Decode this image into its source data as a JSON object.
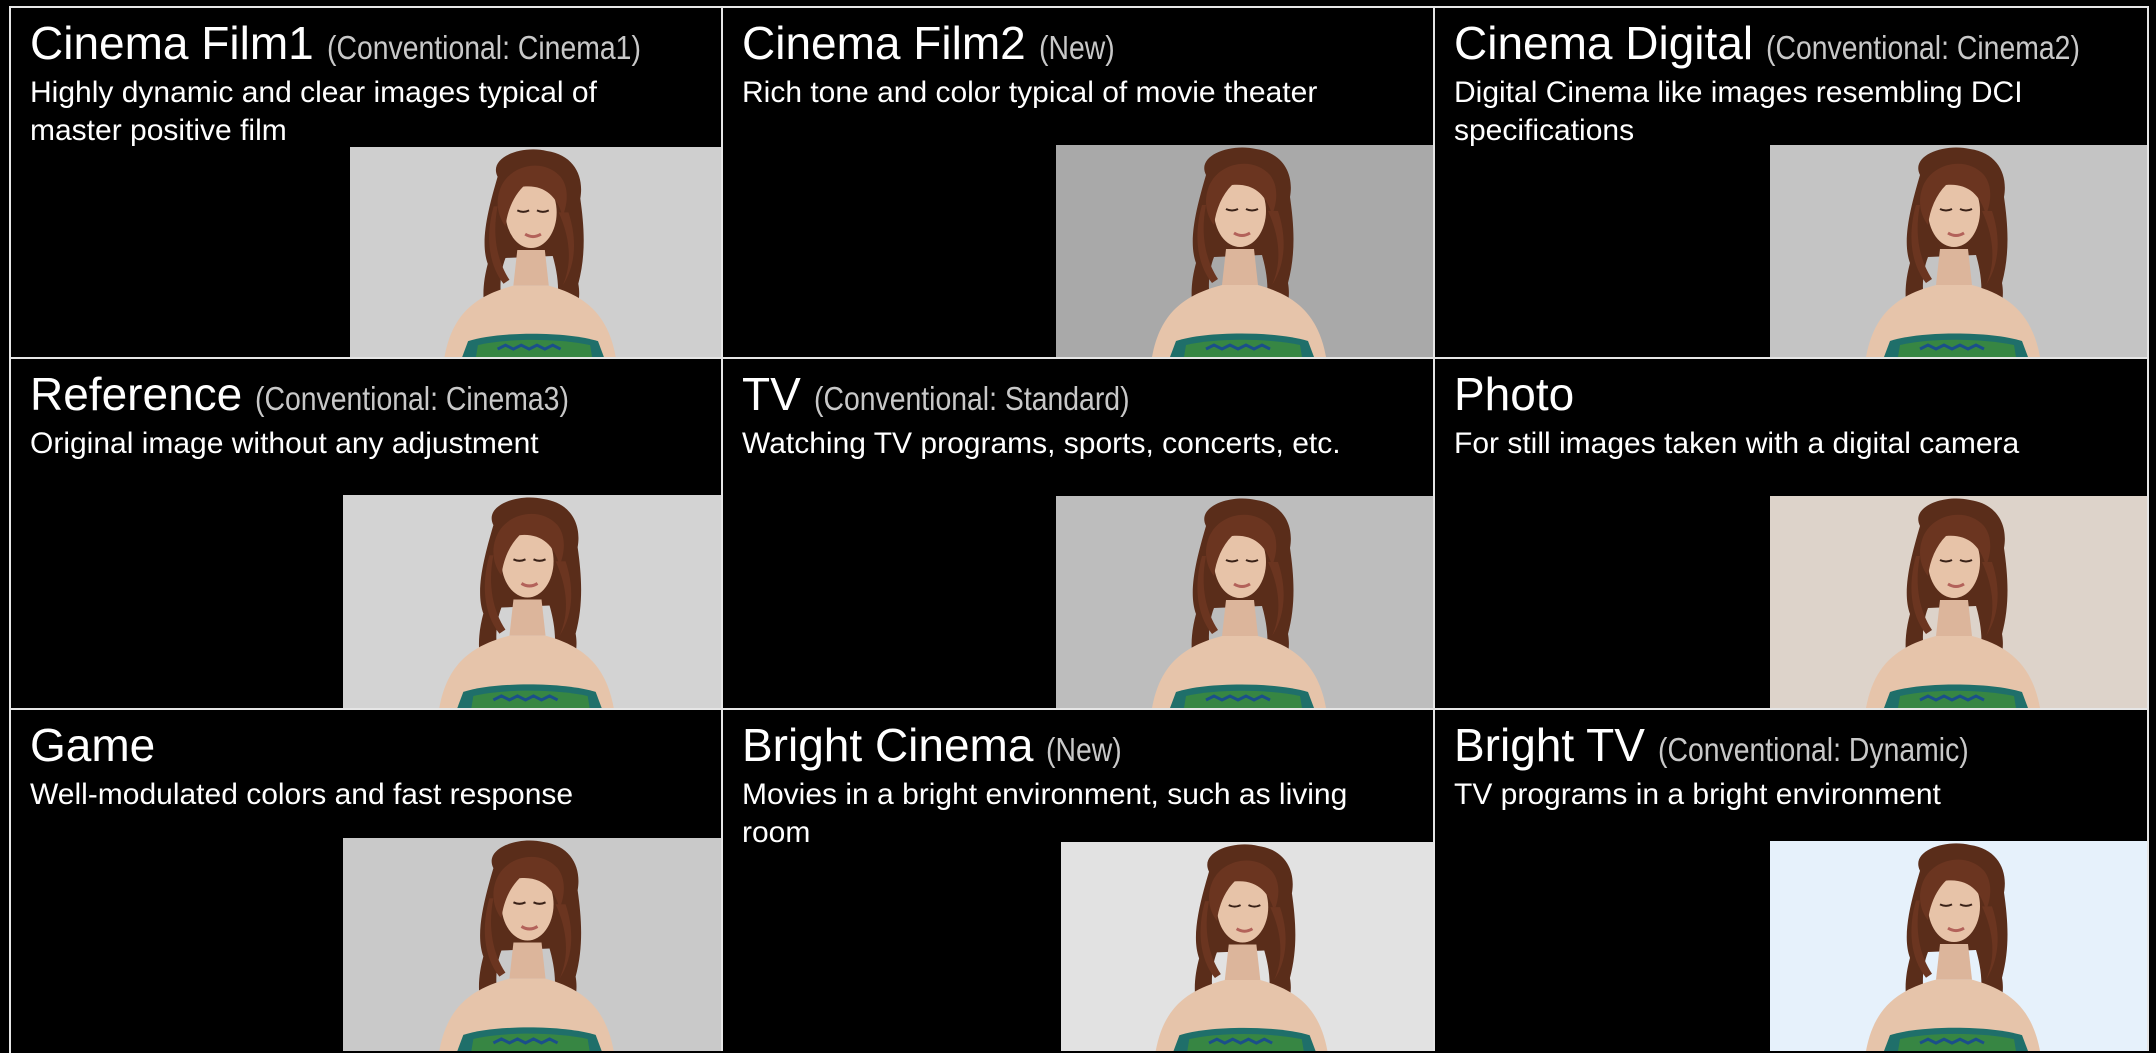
{
  "modes": [
    {
      "title": "Cinema Film1",
      "note": "(Conventional: Cinema1)",
      "description": "Highly dynamic and clear images typical of master positive film",
      "background_color": "#cfcfcf"
    },
    {
      "title": "Cinema Film2",
      "note": "(New)",
      "description": "Rich tone and color typical of movie theater",
      "background_color": "#a9a9a9"
    },
    {
      "title": "Cinema Digital",
      "note": "(Conventional: Cinema2)",
      "description": "Digital Cinema like images resembling DCI specifications",
      "background_color": "#c4c4c4"
    },
    {
      "title": "Reference",
      "note": "(Conventional: Cinema3)",
      "description": "Original image without any adjustment",
      "background_color": "#d3d3d3"
    },
    {
      "title": "TV",
      "note": "(Conventional: Standard)",
      "description": "Watching TV programs, sports, concerts, etc.",
      "background_color": "#bdbdbd"
    },
    {
      "title": "Photo",
      "note": "",
      "description": "For still images taken with a digital camera",
      "background_color": "#ddd3ca"
    },
    {
      "title": "Game",
      "note": "",
      "description": "Well-modulated colors and fast response",
      "background_color": "#c9c9c9"
    },
    {
      "title": "Bright Cinema",
      "note": "(New)",
      "description": "Movies in a bright environment, such as living room",
      "background_color": "#e2e2e2"
    },
    {
      "title": "Bright TV",
      "note": "(Conventional: Dynamic)",
      "description": "TV programs in a bright environment",
      "background_color": "#e6f1fb"
    }
  ]
}
